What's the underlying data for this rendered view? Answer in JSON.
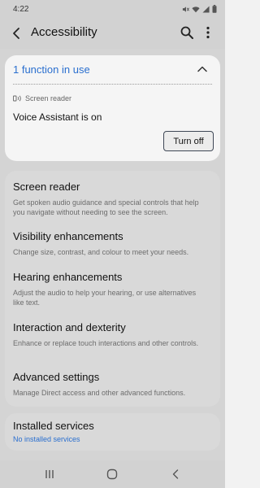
{
  "status_bar": {
    "time": "4:22"
  },
  "header": {
    "title": "Accessibility"
  },
  "active_function": {
    "title": "1 function in use",
    "service_label": "Screen reader",
    "status_text": "Voice Assistant is on",
    "turn_off_label": "Turn off"
  },
  "menu": {
    "items": [
      {
        "title": "Screen reader",
        "description": "Get spoken audio guidance and special controls that help you navigate without needing to see the screen."
      },
      {
        "title": "Visibility enhancements",
        "description": "Change size, contrast, and colour to meet your needs."
      },
      {
        "title": "Hearing enhancements",
        "description": "Adjust the audio to help your hearing, or use alternatives like text."
      },
      {
        "title": "Interaction and dexterity",
        "description": "Enhance or replace touch interactions and other controls."
      },
      {
        "title": "Advanced settings",
        "description": "Manage Direct access and other advanced functions."
      }
    ]
  },
  "installed_services": {
    "title": "Installed services",
    "subtitle": "No installed services"
  },
  "colors": {
    "accent": "#2a6fcf",
    "scrim": "#d4d4d4",
    "card": "#f5f5f5"
  },
  "icons": {
    "status": [
      "mute-icon",
      "wifi-icon",
      "signal-icon",
      "battery-icon"
    ],
    "nav": [
      "recents-icon",
      "home-icon",
      "back-nav-icon"
    ]
  }
}
